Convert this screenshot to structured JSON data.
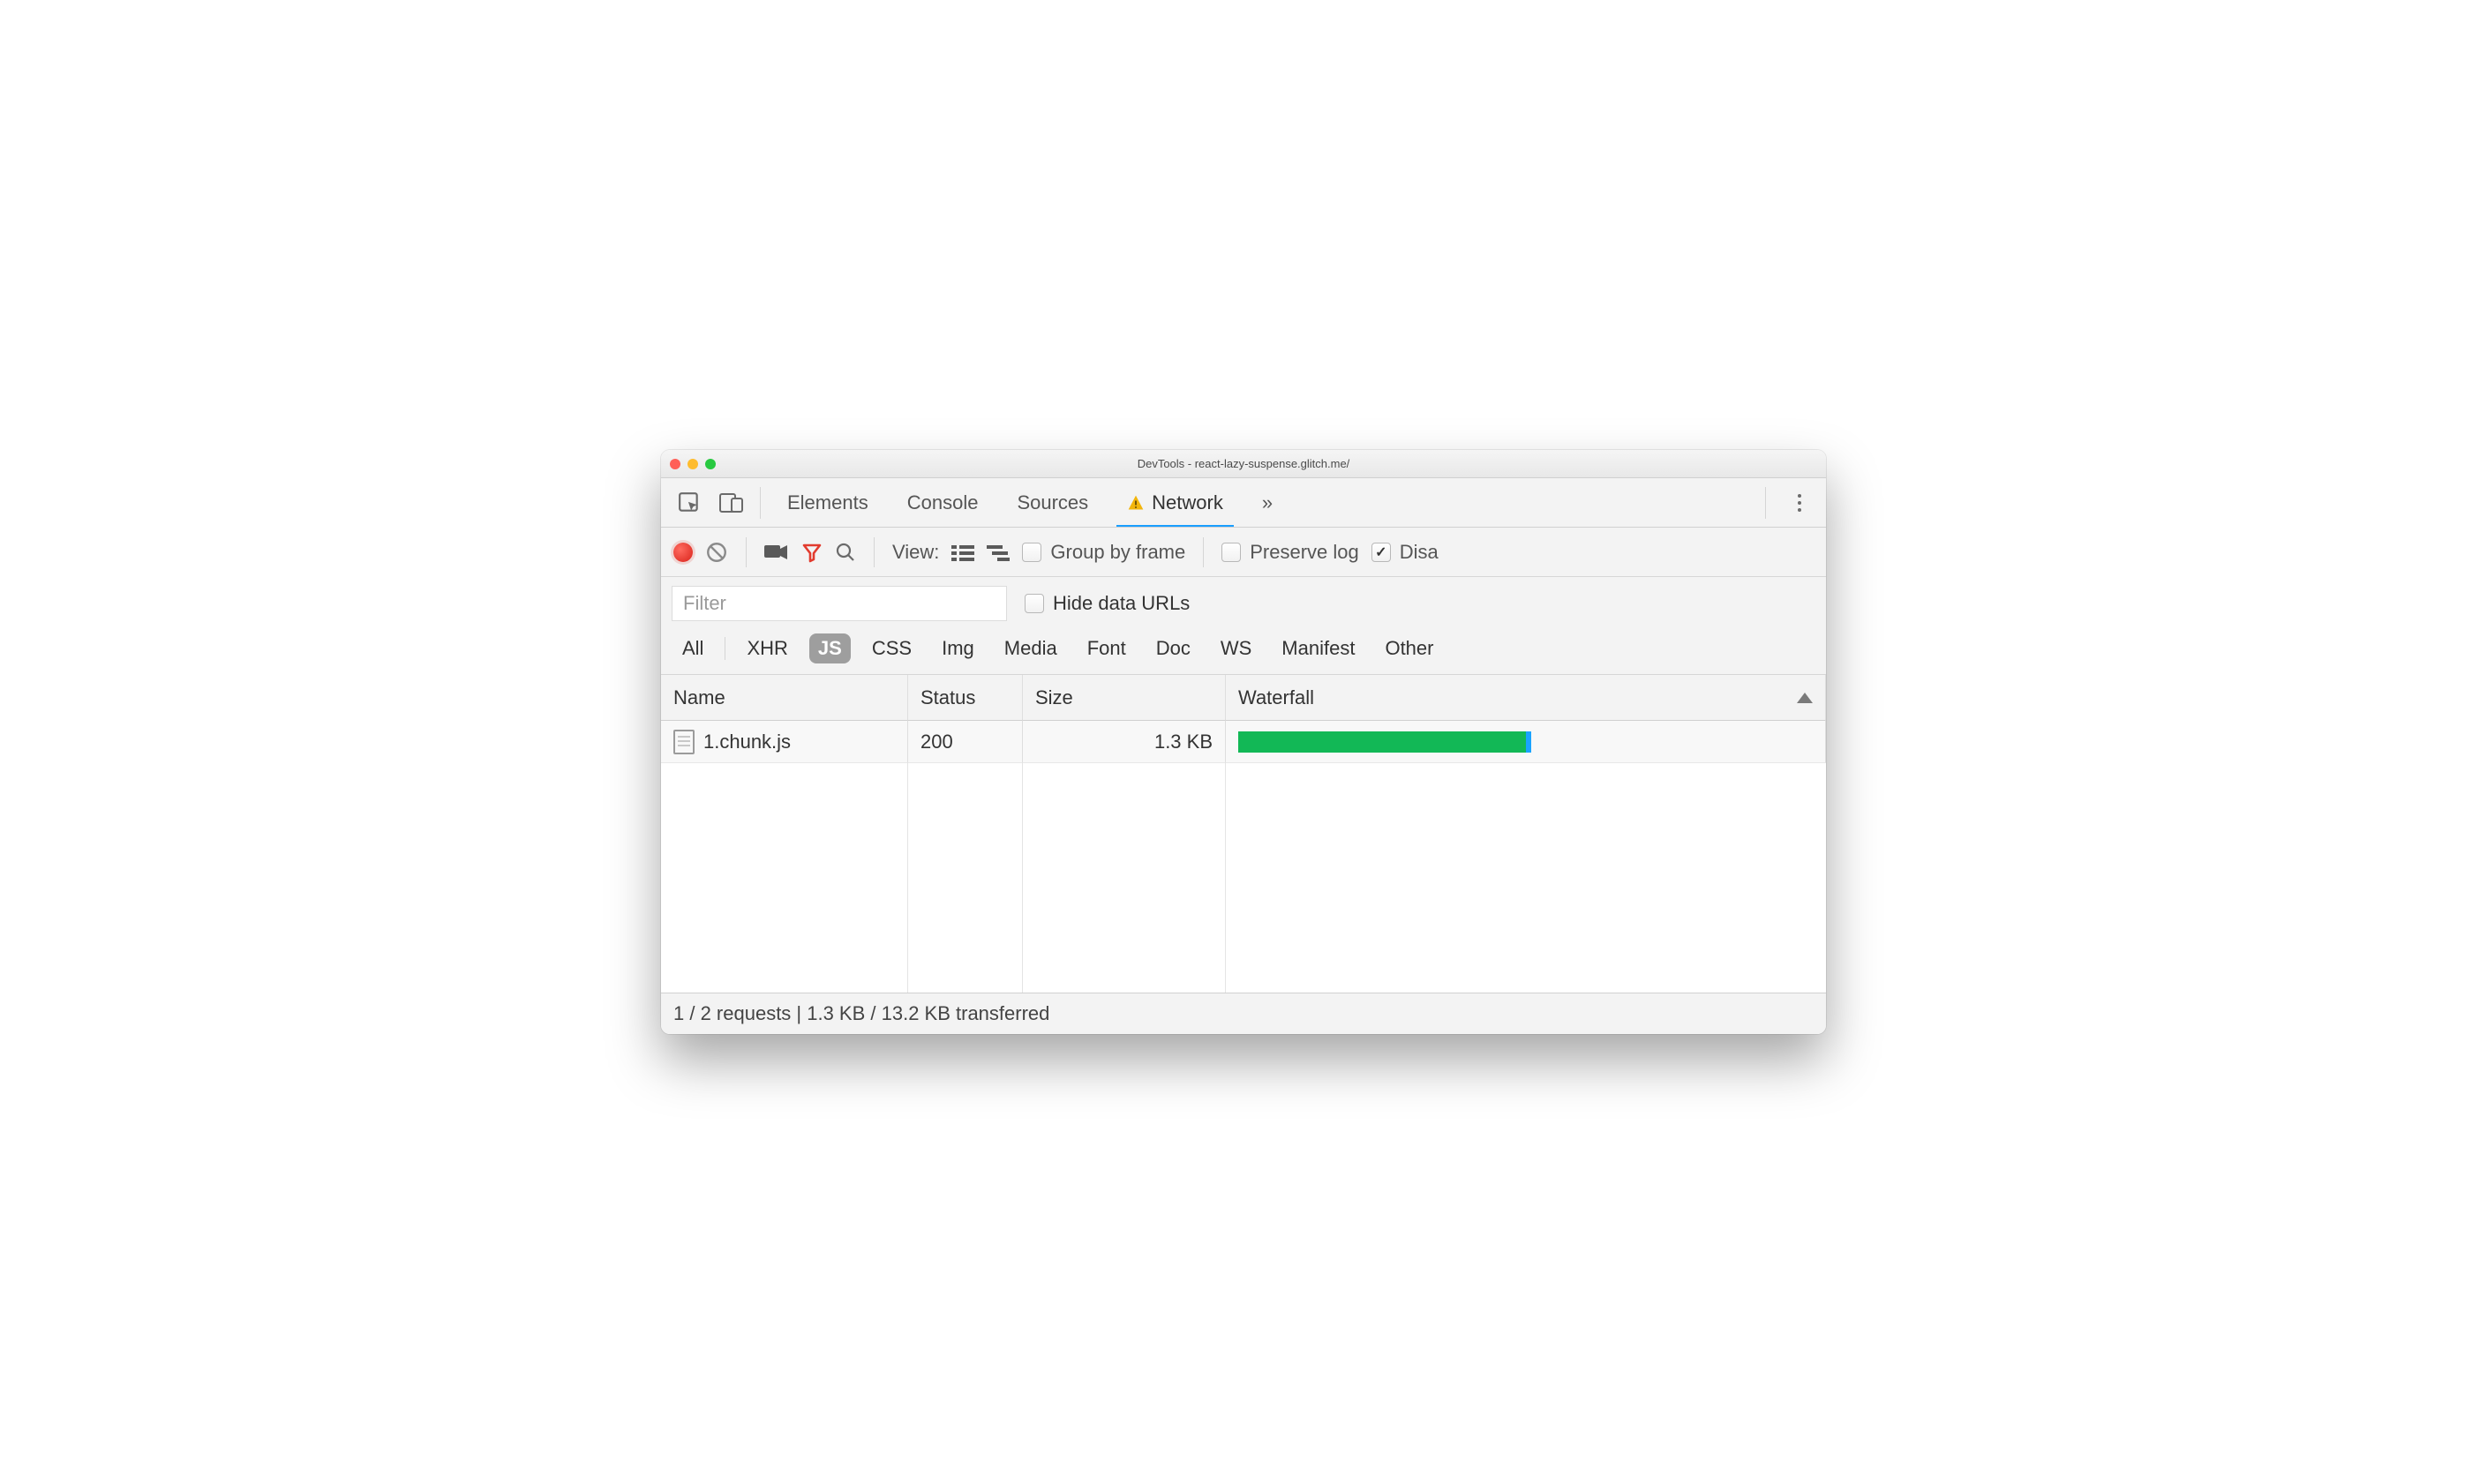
{
  "window": {
    "title": "DevTools - react-lazy-suspense.glitch.me/"
  },
  "tabs": {
    "items": [
      "Elements",
      "Console",
      "Sources",
      "Network"
    ],
    "active_index": 3,
    "overflow_glyph": "»"
  },
  "toolbar": {
    "view_label": "View:",
    "group_by_frame": "Group by frame",
    "preserve_log": "Preserve log",
    "disable_cache": "Disa"
  },
  "filter": {
    "placeholder": "Filter",
    "hide_data_urls": "Hide data URLs"
  },
  "type_filters": [
    "All",
    "XHR",
    "JS",
    "CSS",
    "Img",
    "Media",
    "Font",
    "Doc",
    "WS",
    "Manifest",
    "Other"
  ],
  "type_selected_index": 2,
  "columns": {
    "name": "Name",
    "status": "Status",
    "size": "Size",
    "waterfall": "Waterfall"
  },
  "rows": [
    {
      "name": "1.chunk.js",
      "status": "200",
      "size": "1.3 KB",
      "wf_start_pct": 0,
      "wf_width_pct": 50
    }
  ],
  "statusbar": "1 / 2 requests | 1.3 KB / 13.2 KB transferred"
}
